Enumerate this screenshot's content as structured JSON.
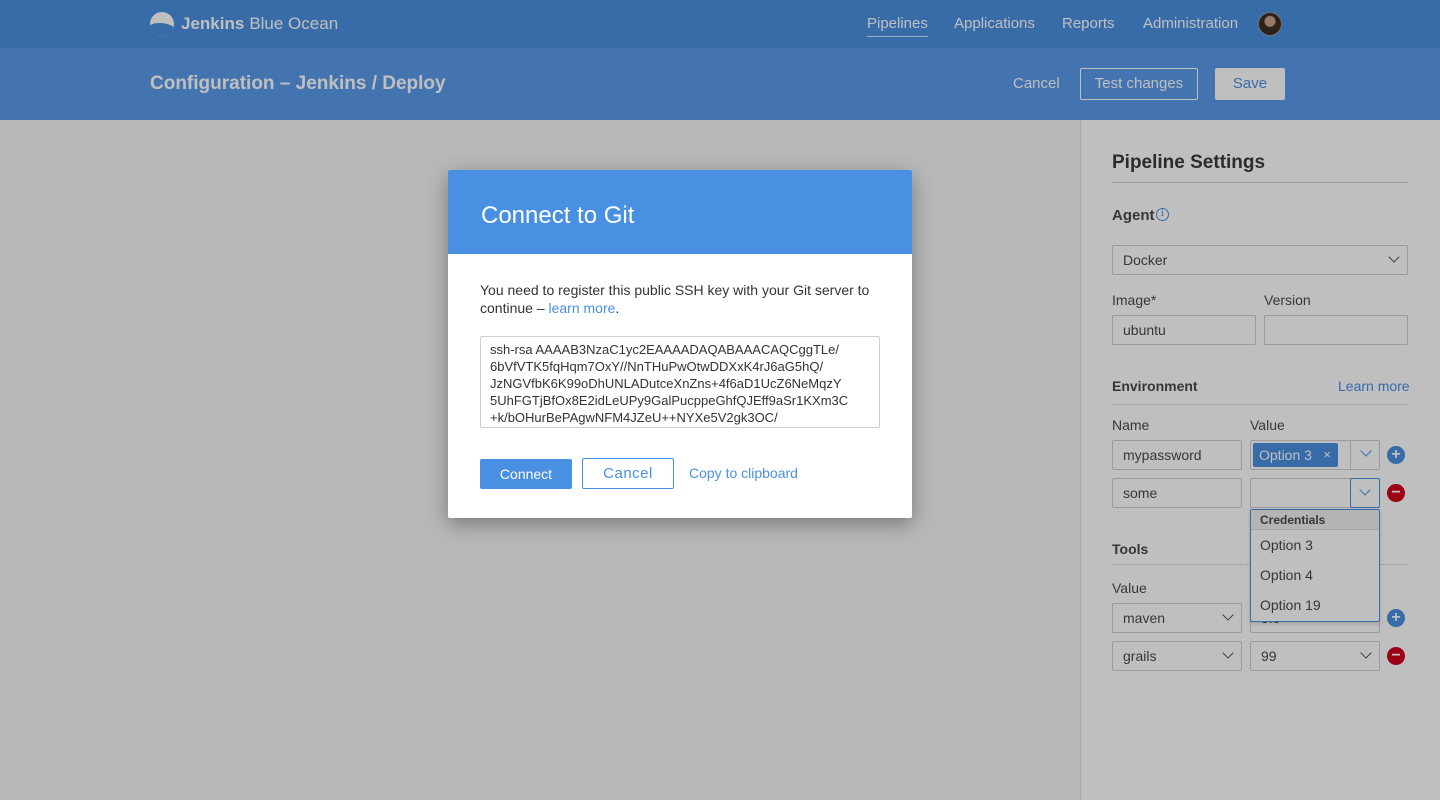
{
  "nav": {
    "brand_bold": "Jenkins",
    "brand_rest": "Blue Ocean",
    "items": [
      {
        "label": "Pipelines",
        "active": true
      },
      {
        "label": "Applications",
        "active": false
      },
      {
        "label": "Reports",
        "active": false
      },
      {
        "label": "Administration",
        "active": false
      }
    ]
  },
  "header": {
    "title": "Configuration – Jenkins / Deploy",
    "cancel_label": "Cancel",
    "test_label": "Test changes",
    "save_label": "Save"
  },
  "settings": {
    "title": "Pipeline Settings",
    "agent_label": "Agent",
    "agent_value": "Docker",
    "image_label": "Image*",
    "image_value": "ubuntu",
    "version_label": "Version",
    "version_value": "",
    "environment_label": "Environment",
    "learn_more": "Learn more",
    "name_col": "Name",
    "value_col": "Value",
    "env_rows": [
      {
        "name": "mypassword",
        "value_tag": "Option 3"
      },
      {
        "name": "some",
        "value_tag": ""
      }
    ],
    "credentials_dropdown": {
      "header": "Credentials",
      "options": [
        "Option 3",
        "Option 4",
        "Option 19"
      ]
    },
    "tools_label": "Tools",
    "tools_value_col": "Value",
    "tools_rows": [
      {
        "tool": "maven",
        "version": "3.5"
      },
      {
        "tool": "grails",
        "version": "99"
      }
    ]
  },
  "modal": {
    "title": "Connect to Git",
    "message": "You need to register this public SSH key with your Git server to continue –",
    "learn_more": "learn more",
    "period": ".",
    "ssh_key_lines": [
      "ssh-rsa AAAAB3NzaC1yc2EAAAADAQABAAACAQCggTLe/",
      "6bVfVTK5fqHqm7OxY//NnTHuPwOtwDDXxK4rJ6aG5hQ/",
      "JzNGVfbK6K99oDhUNLADutceXnZns+4f6aD1UcZ6NeMqzY",
      "5UhFGTjBfOx8E2idLeUPy9GalPucppeGhfQJEff9aSr1KXm3C",
      "+k/bOHurBePAgwNFM4JZeU++NYXe5V2gk3OC/"
    ],
    "connect_label": "Connect",
    "cancel_label": "Cancel",
    "copy_label": "Copy to clipboard"
  }
}
